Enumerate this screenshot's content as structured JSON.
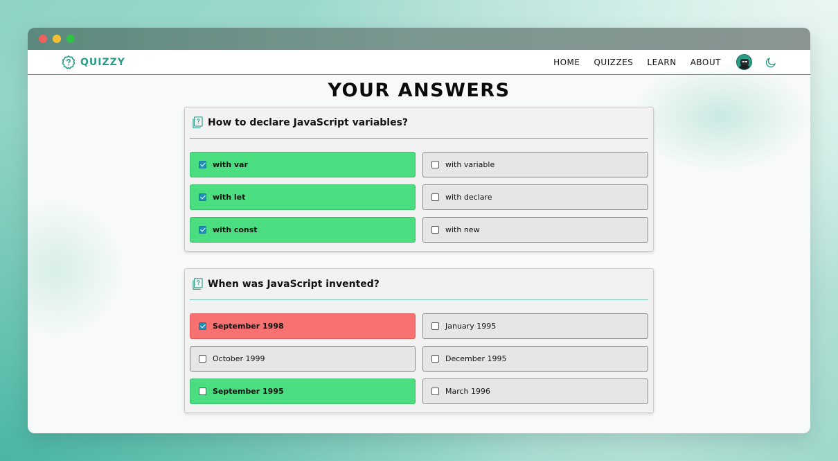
{
  "brand": {
    "name": "QUIZZY"
  },
  "nav": {
    "links": [
      "HOME",
      "QUIZZES",
      "LEARN",
      "ABOUT"
    ]
  },
  "page": {
    "title": "YOUR ANSWERS"
  },
  "questions": [
    {
      "text": "How to declare JavaScript variables?",
      "options": [
        {
          "label": "with var",
          "checked": true,
          "state": "correct"
        },
        {
          "label": "with variable",
          "checked": false,
          "state": "neutral"
        },
        {
          "label": "with let",
          "checked": true,
          "state": "correct"
        },
        {
          "label": "with declare",
          "checked": false,
          "state": "neutral"
        },
        {
          "label": "with const",
          "checked": true,
          "state": "correct"
        },
        {
          "label": "with new",
          "checked": false,
          "state": "neutral"
        }
      ]
    },
    {
      "text": "When was JavaScript invented?",
      "options": [
        {
          "label": "September 1998",
          "checked": true,
          "state": "wrong"
        },
        {
          "label": "January 1995",
          "checked": false,
          "state": "neutral"
        },
        {
          "label": "October 1999",
          "checked": false,
          "state": "neutral"
        },
        {
          "label": "December 1995",
          "checked": false,
          "state": "neutral"
        },
        {
          "label": "September 1995",
          "checked": false,
          "state": "correct"
        },
        {
          "label": "March 1996",
          "checked": false,
          "state": "neutral"
        }
      ]
    }
  ],
  "colors": {
    "accent": "#2a9b86",
    "correct": "#4ade80",
    "wrong": "#f87171",
    "neutral": "#e6e6e6"
  },
  "icons": {
    "logo": "question-badge-icon",
    "question": "question-card-icon",
    "theme": "moon-icon"
  }
}
